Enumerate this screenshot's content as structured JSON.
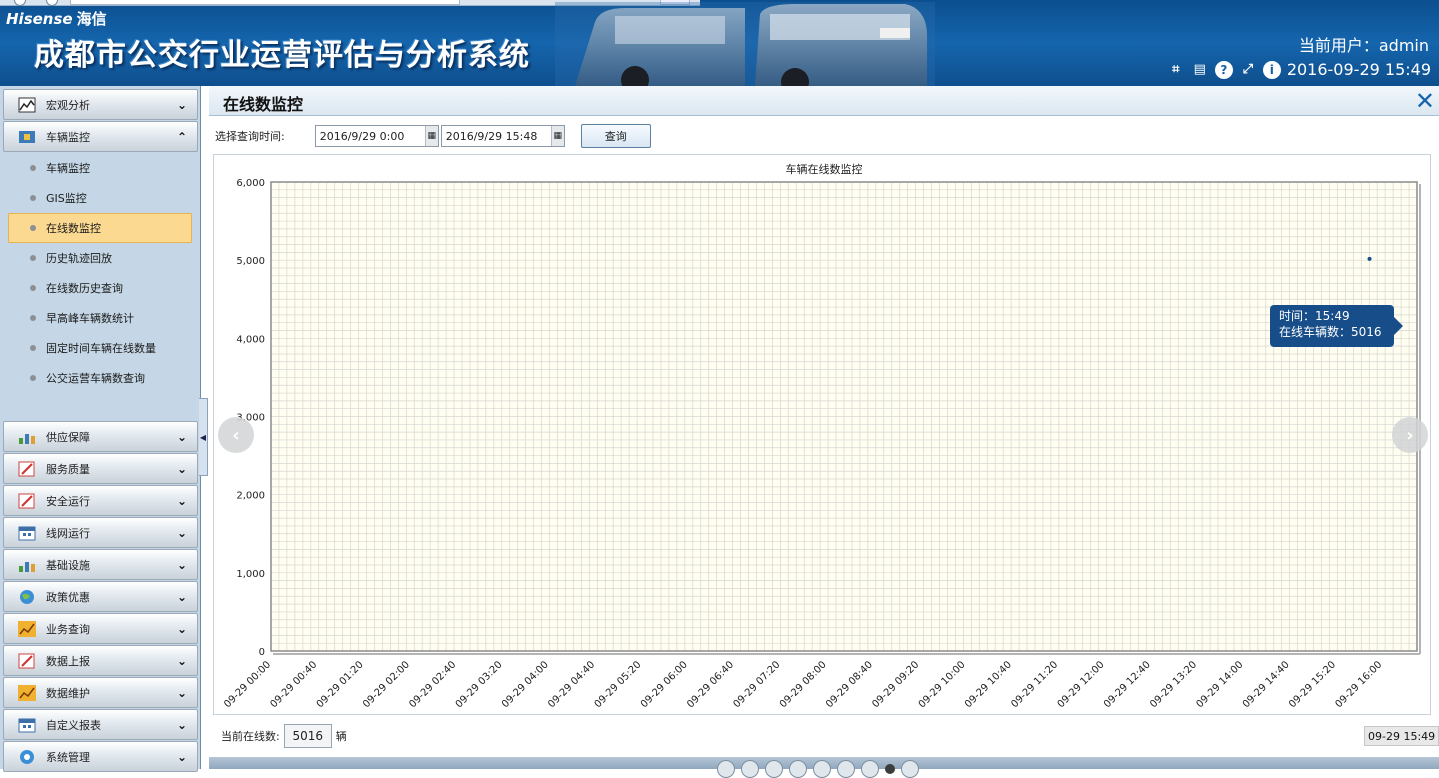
{
  "header": {
    "logo_brand": "Hisense",
    "logo_cn": "海信",
    "system_title": "成都市公交行业运营评估与分析系统",
    "user_label": "当前用户：admin",
    "datetime": "2016-09-29 15:49",
    "icons": [
      "crop-icon",
      "keyboard-icon",
      "help-icon",
      "fullscreen-icon",
      "info-icon"
    ]
  },
  "sidebar": {
    "groups": [
      {
        "label": "宏观分析",
        "icon": "trend-chart-icon",
        "expanded": false
      },
      {
        "label": "车辆监控",
        "icon": "vehicle-monitor-icon",
        "expanded": true
      },
      {
        "label": "供应保障",
        "icon": "bar-chart-icon",
        "expanded": false
      },
      {
        "label": "服务质量",
        "icon": "edit-icon",
        "expanded": false
      },
      {
        "label": "安全运行",
        "icon": "edit-icon",
        "expanded": false
      },
      {
        "label": "线网运行",
        "icon": "calendar-icon",
        "expanded": false
      },
      {
        "label": "基础设施",
        "icon": "bar-chart-icon",
        "expanded": false
      },
      {
        "label": "政策优惠",
        "icon": "globe-icon",
        "expanded": false
      },
      {
        "label": "业务查询",
        "icon": "line-chart-icon",
        "expanded": false
      },
      {
        "label": "数据上报",
        "icon": "edit-icon",
        "expanded": false
      },
      {
        "label": "数据维护",
        "icon": "line-chart-icon",
        "expanded": false
      },
      {
        "label": "自定义报表",
        "icon": "calendar-icon",
        "expanded": false
      },
      {
        "label": "系统管理",
        "icon": "settings-icon",
        "expanded": false
      }
    ],
    "sub_items": [
      {
        "label": "车辆监控",
        "active": false
      },
      {
        "label": "GIS监控",
        "active": false
      },
      {
        "label": "在线数监控",
        "active": true
      },
      {
        "label": "历史轨迹回放",
        "active": false
      },
      {
        "label": "在线数历史查询",
        "active": false
      },
      {
        "label": "早高峰车辆数统计",
        "active": false
      },
      {
        "label": "固定时间车辆在线数量",
        "active": false
      },
      {
        "label": "公交运营车辆数查询",
        "active": false
      }
    ]
  },
  "page": {
    "title": "在线数监控",
    "query_label": "选择查询时间:",
    "start_time": "2016/9/29 0:00",
    "end_time": "2016/9/29 15:48",
    "query_button": "查询",
    "online_label": "当前在线数:",
    "online_value": "5016",
    "online_unit": "辆"
  },
  "tooltip": {
    "time_line": "时间：15:49",
    "count_line": "在线车辆数：5016"
  },
  "scroll_label": "09-29 15:49",
  "chart_data": {
    "type": "line",
    "title": "车辆在线数监控",
    "xlabel": "",
    "ylabel": "",
    "ylim": [
      0,
      6000
    ],
    "y_ticks": [
      "0",
      "1,000",
      "2,000",
      "3,000",
      "4,000",
      "5,000",
      "6,000"
    ],
    "x_tick_labels": [
      "09-29 00:00",
      "09-29 00:40",
      "09-29 01:20",
      "09-29 02:00",
      "09-29 02:40",
      "09-29 03:20",
      "09-29 04:00",
      "09-29 04:40",
      "09-29 05:20",
      "09-29 06:00",
      "09-29 06:40",
      "09-29 07:20",
      "09-29 08:00",
      "09-29 08:40",
      "09-29 09:20",
      "09-29 10:00",
      "09-29 10:40",
      "09-29 11:20",
      "09-29 12:00",
      "09-29 12:40",
      "09-29 13:20",
      "09-29 14:00",
      "09-29 14:40",
      "09-29 15:20",
      "09-29 16:00"
    ],
    "series": [
      {
        "name": "在线车辆数",
        "points": [
          {
            "x": "09-29 15:49",
            "y": 5016
          }
        ]
      }
    ],
    "grid": true,
    "colors": {
      "plot_bg": "#fffef0",
      "grid": "#d4d6d2",
      "frame": "#8a8a8a"
    }
  },
  "colors": {
    "header_bg": "#1565ad",
    "sidebar_bg": "#c5d7e6",
    "active_item": "#fbd991",
    "tooltip_bg": "#174e8a"
  }
}
